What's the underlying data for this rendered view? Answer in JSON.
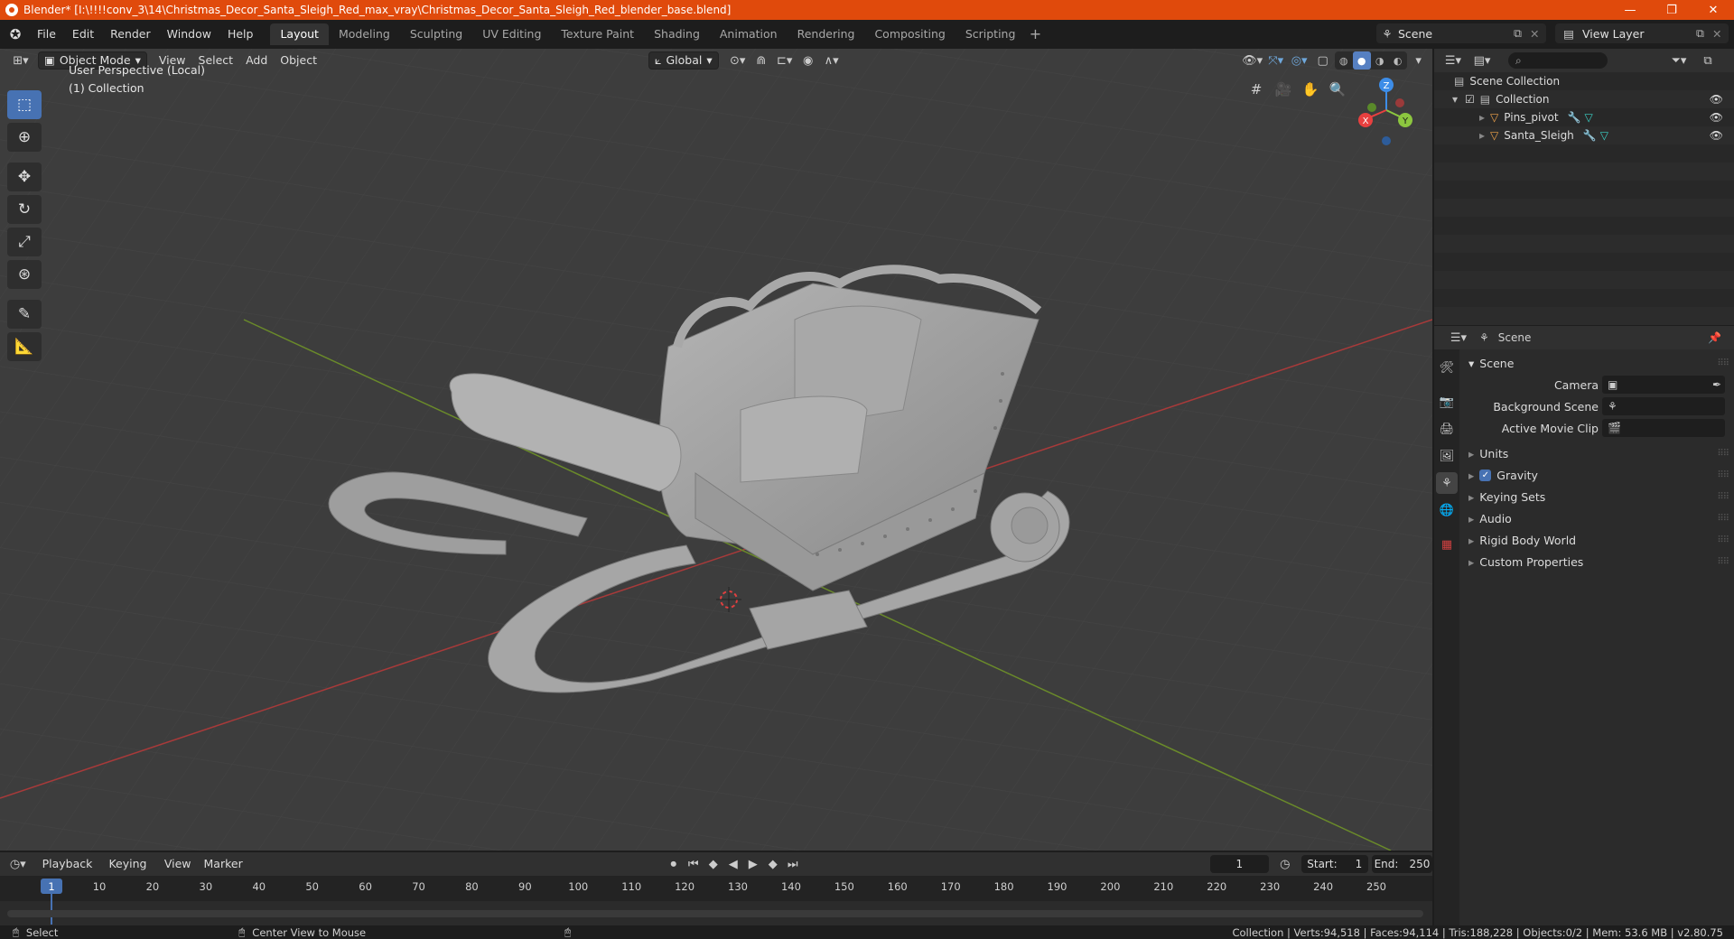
{
  "window": {
    "title": "Blender* [I:\\!!!!conv_3\\14\\Christmas_Decor_Santa_Sleigh_Red_max_vray\\Christmas_Decor_Santa_Sleigh_Red_blender_base.blend]",
    "controls": [
      "—",
      "❐",
      "✕"
    ]
  },
  "menu": [
    "File",
    "Edit",
    "Render",
    "Window",
    "Help"
  ],
  "workspaces": [
    "Layout",
    "Modeling",
    "Sculpting",
    "UV Editing",
    "Texture Paint",
    "Shading",
    "Animation",
    "Rendering",
    "Compositing",
    "Scripting"
  ],
  "active_workspace": "Layout",
  "scene_name": "Scene",
  "view_layer": "View Layer",
  "viewport": {
    "mode": "Object Mode",
    "menus": [
      "View",
      "Select",
      "Add",
      "Object"
    ],
    "orientation": "Global",
    "perspective_label": "User Perspective (Local)",
    "collection_label": "(1) Collection",
    "gizmo_axes": {
      "x": "X",
      "y": "Y",
      "z": "Z"
    }
  },
  "outliner": {
    "search_placeholder": "",
    "root": "Scene Collection",
    "collection": "Collection",
    "objects": [
      "Pins_pivot",
      "Santa_Sleigh"
    ]
  },
  "properties": {
    "header": "Scene",
    "panel": "Scene",
    "fields": [
      {
        "label": "Camera",
        "value": ""
      },
      {
        "label": "Background Scene",
        "value": ""
      },
      {
        "label": "Active Movie Clip",
        "value": ""
      }
    ],
    "subpanels": [
      "Units",
      "Gravity",
      "Keying Sets",
      "Audio",
      "Rigid Body World",
      "Custom Properties"
    ],
    "gravity_checked": true
  },
  "timeline": {
    "menus": [
      "Playback",
      "Keying",
      "View",
      "Marker"
    ],
    "current_frame": "1",
    "start_label": "Start:",
    "start": "1",
    "end_label": "End:",
    "end": "250",
    "ticks": [
      "1",
      "10",
      "20",
      "30",
      "40",
      "50",
      "60",
      "70",
      "80",
      "90",
      "100",
      "110",
      "120",
      "130",
      "140",
      "150",
      "160",
      "170",
      "180",
      "190",
      "200",
      "210",
      "220",
      "230",
      "240",
      "250"
    ]
  },
  "statusbar": {
    "left_action": "Select",
    "middle_action": "Center View to Mouse",
    "stats": "Collection | Verts:94,518 | Faces:94,114 | Tris:188,228 | Objects:0/2 | Mem: 53.6 MB | v2.80.75"
  },
  "colors": {
    "title_bar": "#e04a0c",
    "accent": "#4772b3",
    "viewport_bg": "#3d3d3d",
    "axis_x": "#e8403f",
    "axis_y": "#8cc63f",
    "axis_z": "#3d8de8"
  }
}
